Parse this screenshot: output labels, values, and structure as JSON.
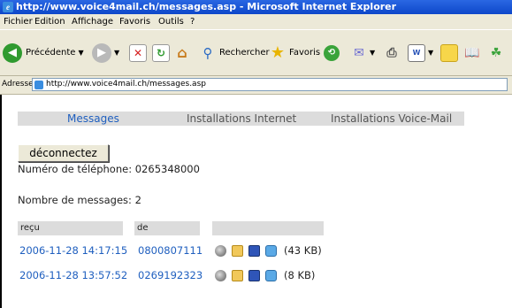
{
  "window": {
    "title": "http://www.voice4mail.ch/messages.asp - Microsoft Internet Explorer"
  },
  "menu": [
    "Fichier",
    "Edition",
    "Affichage",
    "Favoris",
    "Outils",
    "?"
  ],
  "toolbar": {
    "back_label": "Précédente",
    "search_label": "Rechercher",
    "favorites_label": "Favoris"
  },
  "address": {
    "label": "Adresse",
    "url": "http://www.voice4mail.ch/messages.asp"
  },
  "nav": {
    "messages": "Messages",
    "internet": "Installations Internet",
    "voicemail": "Installations Voice-Mail"
  },
  "logout_label": "déconnectez",
  "phone": "Numéro de téléphone: 0265348000",
  "count": "Nombre de messages: 2",
  "table": {
    "headers": [
      "reçu",
      "de"
    ],
    "rows": [
      {
        "received": "2006-11-28 14:17:15",
        "from": "0800807111",
        "size": "(43 KB)"
      },
      {
        "received": "2006-11-28 13:57:52",
        "from": "0269192323",
        "size": "(8 KB)"
      }
    ]
  },
  "colors": {
    "link": "#1f5fbf",
    "band": "#dcdcdc",
    "titlebar": "#0d47c9"
  }
}
